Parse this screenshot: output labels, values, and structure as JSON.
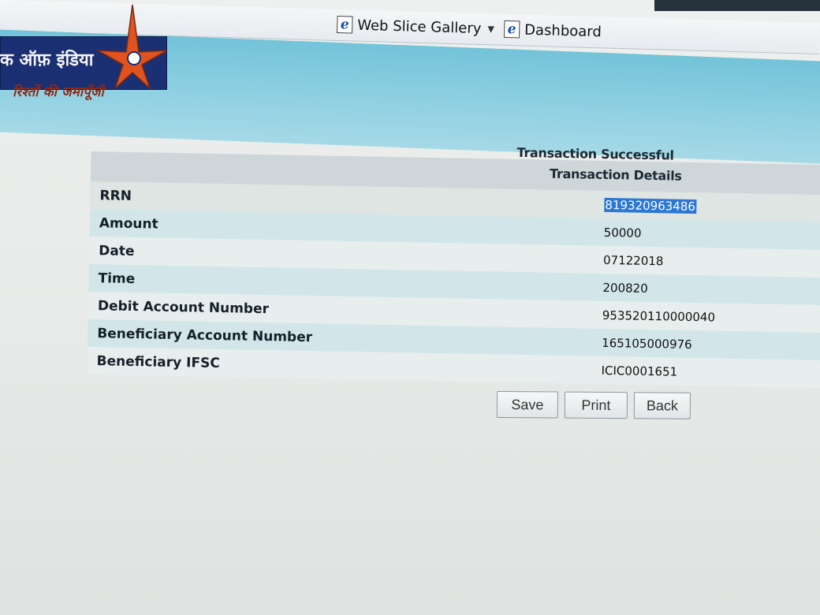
{
  "favorites_bar": {
    "items": [
      {
        "label": "Web Slice Gallery",
        "icon": "ie-icon",
        "has_dropdown": true
      },
      {
        "label": "Dashboard",
        "icon": "ie-icon",
        "has_dropdown": false
      }
    ]
  },
  "banner": {
    "logo_text": "क ऑफ़ इंडिया",
    "tagline": "रिश्तों की जमापूँजी",
    "logo_icon": "star-icon"
  },
  "page": {
    "status_title": "Transaction Successful",
    "details_title": "Transaction Details"
  },
  "details": {
    "rows": [
      {
        "label": "RRN",
        "value": "819320963486",
        "selected": true
      },
      {
        "label": "Amount",
        "value": "50000"
      },
      {
        "label": "Date",
        "value": "07122018"
      },
      {
        "label": "Time",
        "value": "200820"
      },
      {
        "label": "Debit Account Number",
        "value": "953520110000040"
      },
      {
        "label": "Beneficiary Account Number",
        "value": "165105000976"
      },
      {
        "label": "Beneficiary IFSC",
        "value": "ICIC0001651"
      }
    ]
  },
  "actions": {
    "save_label": "Save",
    "print_label": "Print",
    "back_label": "Back"
  },
  "colors": {
    "banner": "#8fd0e2",
    "logo_background": "#1b2f73",
    "star": "#e0531f",
    "selection": "#2d78d4"
  }
}
